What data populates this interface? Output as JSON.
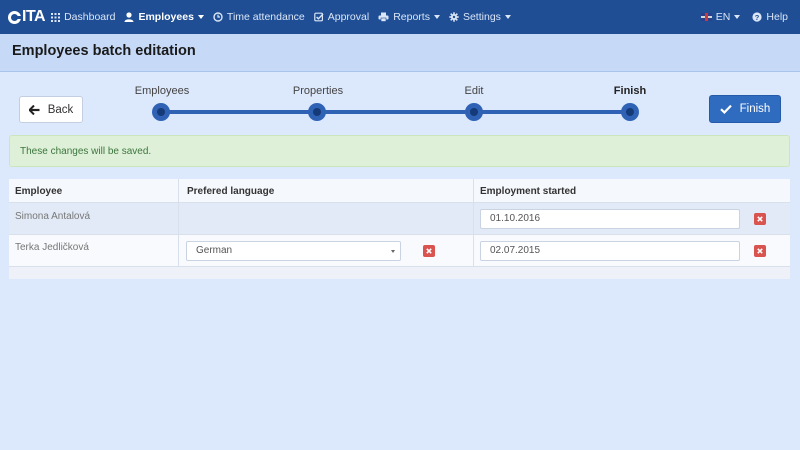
{
  "nav": {
    "logo": "ITA",
    "items": [
      {
        "label": "Dashboard",
        "icon": "grid-icon"
      },
      {
        "label": "Employees",
        "icon": "user-icon"
      },
      {
        "label": "Time attendance",
        "icon": "clock-icon"
      },
      {
        "label": "Approval",
        "icon": "check-square-icon"
      },
      {
        "label": "Reports",
        "icon": "print-icon"
      },
      {
        "label": "Settings",
        "icon": "gear-icon"
      }
    ],
    "language": "EN",
    "help": "Help"
  },
  "page": {
    "title": "Employees batch editation"
  },
  "actions": {
    "back": "Back",
    "finish": "Finish"
  },
  "steps": [
    {
      "label": "Employees",
      "current": false
    },
    {
      "label": "Properties",
      "current": false
    },
    {
      "label": "Edit",
      "current": false
    },
    {
      "label": "Finish",
      "current": true
    }
  ],
  "alert": "These changes will be saved.",
  "table": {
    "headers": [
      "Employee",
      "Prefered language",
      "Employment started"
    ],
    "rows": [
      {
        "employee": "Simona Antalová",
        "language": "",
        "employment_started": "01.10.2016"
      },
      {
        "employee": "Terka Jedličková",
        "language": "German",
        "employment_started": "02.07.2015"
      }
    ]
  },
  "colors": {
    "navbar": "#1f4e95",
    "accent": "#2f6bbf",
    "remove": "#d9534f",
    "alert_bg": "#dff0d8"
  }
}
